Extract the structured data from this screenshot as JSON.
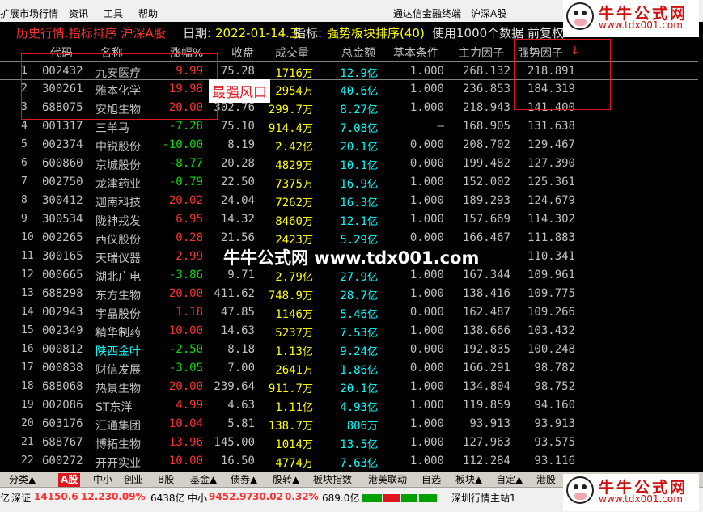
{
  "menu": {
    "items": [
      "扩展市场行情",
      "资讯",
      "工具",
      "帮助"
    ],
    "center_title": "通达信金融终端",
    "market": "沪深A股"
  },
  "infobar": {
    "title": "历史行情.指标排序 沪深A股",
    "date_label": "日期:",
    "date_value": "2022-01-14.五",
    "indicator_label": "指标:",
    "indicator_value": "强势板块排序(40)",
    "extra": "使用1000个数据 前复权"
  },
  "columns": [
    "代码",
    "名称",
    "涨幅%",
    "收盘",
    "成交量",
    "总金额",
    "基本条件",
    "主力因子",
    "强势因子"
  ],
  "sort_arrow": "↓",
  "rows": [
    {
      "idx": "1",
      "code": "002432",
      "name": "九安医疗",
      "chg": "9.99",
      "close": "75.28",
      "vol": "1716",
      "vol_unit": "万",
      "amt": "12.9",
      "amt_unit": "亿",
      "base": "1.000",
      "main": "268.132",
      "strength": "218.891",
      "dir": "up"
    },
    {
      "idx": "2",
      "code": "300261",
      "name": "雅本化学",
      "chg": "19.98",
      "close": "13.76",
      "vol": "2954",
      "vol_unit": "万",
      "amt": "40.6",
      "amt_unit": "亿",
      "base": "1.000",
      "main": "236.853",
      "strength": "184.319",
      "dir": "up"
    },
    {
      "idx": "3",
      "code": "688075",
      "name": "安旭生物",
      "chg": "20.00",
      "close": "302.76",
      "vol": "299.7",
      "vol_unit": "万",
      "amt": "8.27",
      "amt_unit": "亿",
      "base": "1.000",
      "main": "218.943",
      "strength": "141.400",
      "dir": "up"
    },
    {
      "idx": "4",
      "code": "001317",
      "name": "三羊马",
      "chg": "-7.28",
      "close": "75.10",
      "vol": "914.4",
      "vol_unit": "万",
      "amt": "7.08",
      "amt_unit": "亿",
      "base": "–",
      "main": "168.905",
      "strength": "131.638",
      "dir": "down"
    },
    {
      "idx": "5",
      "code": "002374",
      "name": "中锐股份",
      "chg": "-10.00",
      "close": "8.19",
      "vol": "2.42",
      "vol_unit": "亿",
      "amt": "20.1",
      "amt_unit": "亿",
      "base": "0.000",
      "main": "208.702",
      "strength": "129.467",
      "dir": "down"
    },
    {
      "idx": "6",
      "code": "600860",
      "name": "京城股份",
      "chg": "-8.77",
      "close": "20.28",
      "vol": "4829",
      "vol_unit": "万",
      "amt": "10.1",
      "amt_unit": "亿",
      "base": "0.000",
      "main": "199.482",
      "strength": "127.390",
      "dir": "down"
    },
    {
      "idx": "7",
      "code": "002750",
      "name": "龙津药业",
      "chg": "-0.79",
      "close": "22.50",
      "vol": "7375",
      "vol_unit": "万",
      "amt": "16.9",
      "amt_unit": "亿",
      "base": "1.000",
      "main": "152.002",
      "strength": "125.361",
      "dir": "down"
    },
    {
      "idx": "8",
      "code": "300412",
      "name": "迦南科技",
      "chg": "20.02",
      "close": "24.04",
      "vol": "7262",
      "vol_unit": "万",
      "amt": "16.3",
      "amt_unit": "亿",
      "base": "1.000",
      "main": "189.293",
      "strength": "124.679",
      "dir": "up"
    },
    {
      "idx": "9",
      "code": "300534",
      "name": "陇神戎发",
      "chg": "6.95",
      "close": "14.32",
      "vol": "8460",
      "vol_unit": "万",
      "amt": "12.1",
      "amt_unit": "亿",
      "base": "1.000",
      "main": "157.669",
      "strength": "114.302",
      "dir": "up"
    },
    {
      "idx": "10",
      "code": "002265",
      "name": "西仪股份",
      "chg": "0.28",
      "close": "21.56",
      "vol": "2423",
      "vol_unit": "万",
      "amt": "5.29",
      "amt_unit": "亿",
      "base": "0.000",
      "main": "166.467",
      "strength": "111.883",
      "dir": "up"
    },
    {
      "idx": "11",
      "code": "300165",
      "name": "天瑞仪器",
      "chg": "2.99",
      "close": "",
      "vol": "",
      "vol_unit": "",
      "amt": "",
      "amt_unit": "",
      "base": "",
      "main": "",
      "strength": "110.341",
      "dir": "up"
    },
    {
      "idx": "12",
      "code": "000665",
      "name": "湖北广电",
      "chg": "-3.86",
      "close": "9.71",
      "vol": "2.79",
      "vol_unit": "亿",
      "amt": "27.9",
      "amt_unit": "亿",
      "base": "1.000",
      "main": "167.344",
      "strength": "109.961",
      "dir": "down"
    },
    {
      "idx": "13",
      "code": "688298",
      "name": "东方生物",
      "chg": "20.00",
      "close": "411.62",
      "vol": "748.9",
      "vol_unit": "万",
      "amt": "28.7",
      "amt_unit": "亿",
      "base": "1.000",
      "main": "138.416",
      "strength": "109.775",
      "dir": "up"
    },
    {
      "idx": "14",
      "code": "002943",
      "name": "宇晶股份",
      "chg": "1.18",
      "close": "47.85",
      "vol": "1146",
      "vol_unit": "万",
      "amt": "5.46",
      "amt_unit": "亿",
      "base": "0.000",
      "main": "162.487",
      "strength": "109.266",
      "dir": "up"
    },
    {
      "idx": "15",
      "code": "002349",
      "name": "精华制药",
      "chg": "10.00",
      "close": "14.63",
      "vol": "5237",
      "vol_unit": "万",
      "amt": "7.53",
      "amt_unit": "亿",
      "base": "1.000",
      "main": "138.666",
      "strength": "103.432",
      "dir": "up"
    },
    {
      "idx": "16",
      "code": "000812",
      "name": "陕西金叶",
      "chg": "-2.50",
      "close": "8.18",
      "vol": "1.13",
      "vol_unit": "亿",
      "amt": "9.24",
      "amt_unit": "亿",
      "base": "0.000",
      "main": "192.835",
      "strength": "100.248",
      "dir": "down",
      "name_color": "#00ffff"
    },
    {
      "idx": "17",
      "code": "000838",
      "name": "财信发展",
      "chg": "-3.05",
      "close": "7.00",
      "vol": "2641",
      "vol_unit": "万",
      "amt": "1.86",
      "amt_unit": "亿",
      "base": "0.000",
      "main": "166.291",
      "strength": "98.782",
      "dir": "down"
    },
    {
      "idx": "18",
      "code": "688068",
      "name": "热景生物",
      "chg": "20.00",
      "close": "239.64",
      "vol": "911.7",
      "vol_unit": "万",
      "amt": "20.1",
      "amt_unit": "亿",
      "base": "1.000",
      "main": "134.804",
      "strength": "98.752",
      "dir": "up"
    },
    {
      "idx": "19",
      "code": "002086",
      "name": "ST东洋",
      "chg": "4.99",
      "close": "4.63",
      "vol": "1.11",
      "vol_unit": "亿",
      "amt": "4.93",
      "amt_unit": "亿",
      "base": "1.000",
      "main": "119.859",
      "strength": "94.160",
      "dir": "up"
    },
    {
      "idx": "20",
      "code": "603176",
      "name": "汇通集团",
      "chg": "10.04",
      "close": "5.81",
      "vol": "138.7",
      "vol_unit": "万",
      "amt": "806",
      "amt_unit": "万",
      "base": "1.000",
      "main": "93.913",
      "strength": "93.913",
      "dir": "up"
    },
    {
      "idx": "21",
      "code": "688767",
      "name": "博拓生物",
      "chg": "13.96",
      "close": "145.00",
      "vol": "1014",
      "vol_unit": "万",
      "amt": "13.5",
      "amt_unit": "亿",
      "base": "1.000",
      "main": "127.963",
      "strength": "93.575",
      "dir": "up"
    },
    {
      "idx": "22",
      "code": "600272",
      "name": "开开实业",
      "chg": "10.00",
      "close": "16.50",
      "vol": "4774",
      "vol_unit": "万",
      "amt": "7.63",
      "amt_unit": "亿",
      "base": "1.000",
      "main": "112.284",
      "strength": "93.116",
      "dir": "up"
    }
  ],
  "annotation": "最强风口",
  "watermark": "牛牛公式网 www.tdx001.com",
  "logo": {
    "title": "牛牛公式网",
    "url": "www.tdx001.com"
  },
  "tabs": [
    "分类▲",
    "A股",
    "中小",
    "创业",
    "B股",
    "基金▲",
    "债券▲",
    "股转▲",
    "板块指数",
    "港美联动",
    "自选",
    "板块▲",
    "自定▲",
    "港股"
  ],
  "active_tab": "A股",
  "status": {
    "sz_label": "深证",
    "sz_index": "14150.6",
    "sz_change": "12.23",
    "sz_pct": "0.09%",
    "sz_amount": "6438亿",
    "zx_label": "中小",
    "zx_index": "9452.97",
    "zx_change": "30.02",
    "zx_pct": "0.32%",
    "zx_amount": "689.0亿",
    "station": "深圳行情主站1",
    "left_edge": "亿"
  },
  "colors": {
    "up": "#ff3030",
    "down": "#00e000",
    "accent": "#e0161e",
    "amount": "#00ffff",
    "volume": "#ffff00"
  }
}
